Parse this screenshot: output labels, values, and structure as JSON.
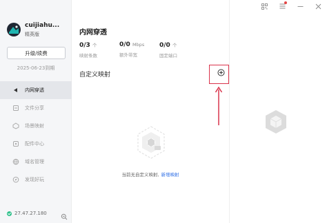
{
  "app": {
    "username": "cuijiahu...",
    "plan": "精英版",
    "upgrade_label": "升级/续费",
    "expire_text": "2025-06-23到期",
    "ip": "27.47.27.180"
  },
  "nav": [
    {
      "label": "内网穿透",
      "icon": "link-icon",
      "active": true
    },
    {
      "label": "文件分享",
      "icon": "file-share-icon",
      "active": false
    },
    {
      "label": "场景映射",
      "icon": "scene-icon",
      "active": false
    },
    {
      "label": "配件中心",
      "icon": "accessories-icon",
      "active": false
    },
    {
      "label": "域名管理",
      "icon": "domain-icon",
      "active": false
    },
    {
      "label": "发现好玩",
      "icon": "discover-icon",
      "active": false
    }
  ],
  "main": {
    "title": "内网穿透",
    "stats": [
      {
        "value": "0/3",
        "unit": "个",
        "label": "映射条数"
      },
      {
        "value": "0/0",
        "unit": "Mbps",
        "label": "额外带宽"
      },
      {
        "value": "0/0",
        "unit": "个",
        "label": "固定端口"
      }
    ],
    "section_title": "自定义映射",
    "empty_text": "当前无自定义映射,",
    "new_link": "新增映射"
  },
  "titlebar": {
    "icons": [
      "qr-code-icon",
      "menu-icon",
      "minimize-icon",
      "close-icon"
    ]
  },
  "colors": {
    "accent": "#2f6fe6",
    "highlight": "#d9324a",
    "online": "#2ec08a"
  }
}
